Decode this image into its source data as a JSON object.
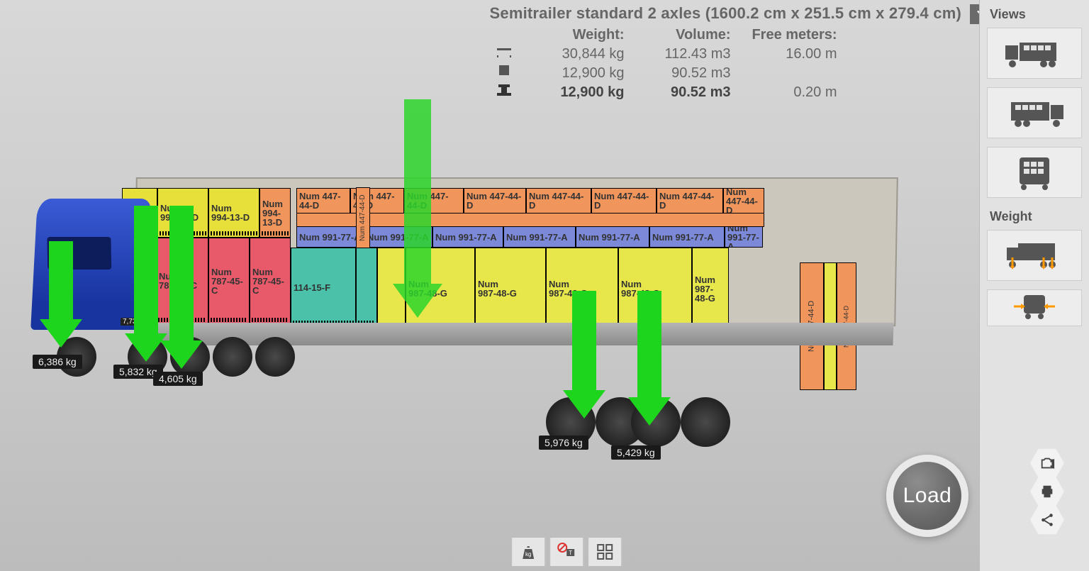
{
  "title": "Semitrailer standard 2 axles (1600.2 cm x 251.5 cm x 279.4 cm)",
  "headers": {
    "weight": "Weight:",
    "volume": "Volume:",
    "free": "Free meters:"
  },
  "rows": {
    "cap": {
      "weight": "30,844 kg",
      "volume": "112.43 m3",
      "free": "16.00 m"
    },
    "cargo": {
      "weight": "12,900 kg",
      "volume": "90.52 m3",
      "free": ""
    },
    "used": {
      "weight": "12,900 kg",
      "volume": "90.52 m3",
      "free": "0.20 m"
    }
  },
  "sidebar": {
    "views_label": "Views",
    "weight_label": "Weight"
  },
  "load_button": "Load",
  "axles": [
    {
      "id": "front1",
      "label": "6,386 kg"
    },
    {
      "id": "front2",
      "label": "5,832 kg"
    },
    {
      "id": "front3",
      "label": "4,605 kg"
    },
    {
      "id": "rear1",
      "label": "5,976 kg"
    },
    {
      "id": "rear2",
      "label": "5,429 kg"
    }
  ],
  "cab_plate": "7,732 kg",
  "cargo": {
    "d994": "Num\n994-13-D",
    "c787": "Num\n787-45-C",
    "d447_h": "Num 447-44-D",
    "d447_v": "Num 447-44-D",
    "a991": "Num 991-77-A",
    "g987": "Num\n987-48-G",
    "f114": "114-15-F"
  }
}
